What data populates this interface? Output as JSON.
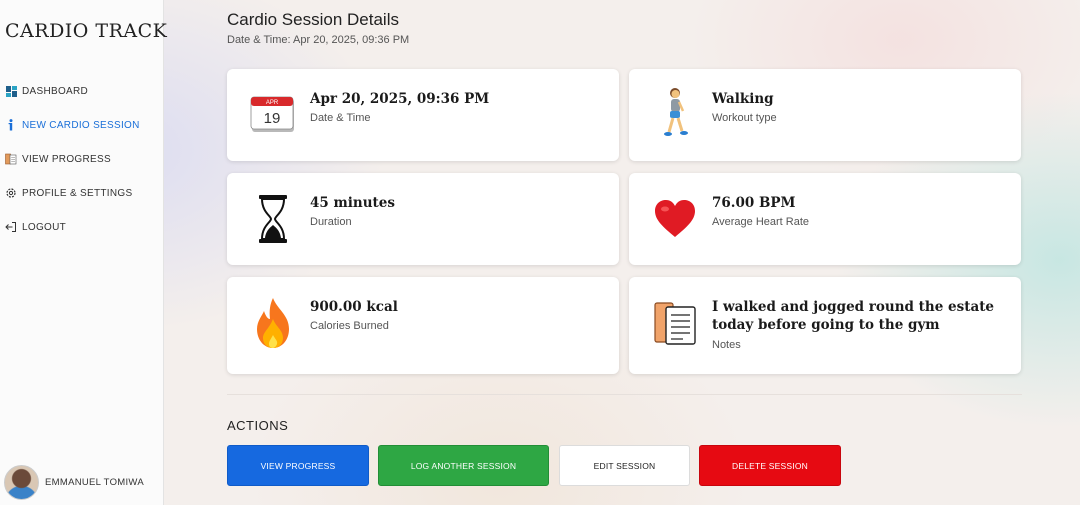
{
  "app": {
    "brand": "CARDIO TRACK"
  },
  "sidebar": {
    "items": [
      {
        "label": "DASHBOARD",
        "icon": "dashboard-icon",
        "active": false
      },
      {
        "label": "NEW CARDIO SESSION",
        "icon": "info-icon",
        "active": true
      },
      {
        "label": "VIEW PROGRESS",
        "icon": "books-icon",
        "active": false
      },
      {
        "label": "PROFILE & SETTINGS",
        "icon": "gear-icon",
        "active": false
      },
      {
        "label": "LOGOUT",
        "icon": "logout-icon",
        "active": false
      }
    ],
    "user": {
      "name": "EMMANUEL TOMIWA"
    }
  },
  "header": {
    "title": "Cardio Session Details",
    "subtitle": "Date & Time: Apr 20, 2025, 09:36 PM"
  },
  "cards": {
    "datetime": {
      "value": "Apr 20, 2025, 09:36 PM",
      "label": "Date & Time",
      "icon": "calendar-icon",
      "cal_month": "APR",
      "cal_day": "19"
    },
    "workout": {
      "value": "Walking",
      "label": "Workout type",
      "icon": "walking-person-icon"
    },
    "duration": {
      "value": "45 minutes",
      "label": "Duration",
      "icon": "hourglass-icon"
    },
    "heart": {
      "value": "76.00 BPM",
      "label": "Average Heart Rate",
      "icon": "heart-icon"
    },
    "calories": {
      "value": "900.00 kcal",
      "label": "Calories Burned",
      "icon": "fire-icon"
    },
    "notes": {
      "value": "I walked and jogged round the estate today before going to the gym",
      "label": "Notes",
      "icon": "notes-icon"
    }
  },
  "actions": {
    "title": "ACTIONS",
    "view_progress": "VIEW PROGRESS",
    "log_another": "LOG ANOTHER SESSION",
    "edit": "EDIT SESSION",
    "delete": "DELETE SESSION"
  },
  "colors": {
    "accent": "#1a6fd8",
    "blue_button": "#1669e0",
    "green_button": "#2ea744",
    "red_button": "#e60a12"
  }
}
